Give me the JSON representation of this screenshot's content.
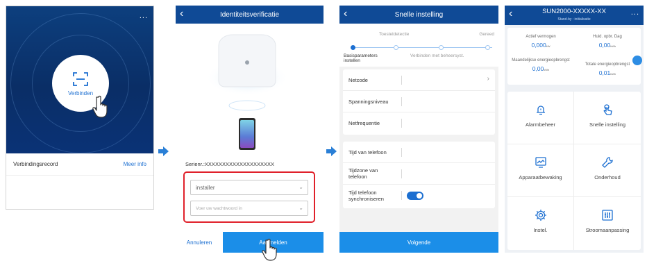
{
  "screen1": {
    "menu": "...",
    "connect_label": "Verbinden",
    "record_label": "Verbindingsrecord",
    "more_info": "Meer info"
  },
  "screen2": {
    "title": "Identiteitsverificatie",
    "serial": "Serienr.:XXXXXXXXXXXXXXXXXXXX",
    "user_value": "installer",
    "password_placeholder": "Voer uw wachtwoord in",
    "cancel": "Annuleren",
    "login": "Aanmelden"
  },
  "screen3": {
    "title": "Snelle instelling",
    "steps": {
      "step1": "Basisparameters instellen",
      "step2": "Toesteldetectie",
      "step3": "Verbinden met beheersyst.",
      "step4": "Gereed"
    },
    "fields": [
      "Netcode",
      "Spanningsniveau",
      "Netfrequentie"
    ],
    "phone_fields": [
      "Tijd van telefoon",
      "Tijdzone van telefoon",
      "Tijd telefoon synchroniseren"
    ],
    "sync_enabled": true,
    "next": "Volgende"
  },
  "screen4": {
    "title": "SUN2000-XXXXX-XX",
    "status": "Stand-by : initialisatie",
    "stats": [
      {
        "label": "Actief vermogen",
        "value": "0,000",
        "unit": "kW"
      },
      {
        "label": "Huid. opbr. Dag",
        "value": "0,00",
        "unit": "kWh"
      },
      {
        "label": "Maandelijkse energieopbrengst",
        "value": "0,00",
        "unit": "kWh"
      },
      {
        "label": "Totale energieopbrengst",
        "value": "0,01",
        "unit": "kWh"
      }
    ],
    "tiles": [
      {
        "label": "Alarmbeheer",
        "icon": "bell-icon"
      },
      {
        "label": "Snelle instelling",
        "icon": "touch-icon"
      },
      {
        "label": "Apparaatbewaking",
        "icon": "monitor-icon"
      },
      {
        "label": "Onderhoud",
        "icon": "wrench-icon"
      },
      {
        "label": "Instel.",
        "icon": "gear-icon"
      },
      {
        "label": "Stroomaanpassing",
        "icon": "sliders-icon"
      }
    ]
  },
  "colors": {
    "header_blue": "#0f4a96",
    "accent_blue": "#1b8ee8",
    "link_blue": "#1c6fd1",
    "highlight_red": "#e0202a"
  }
}
